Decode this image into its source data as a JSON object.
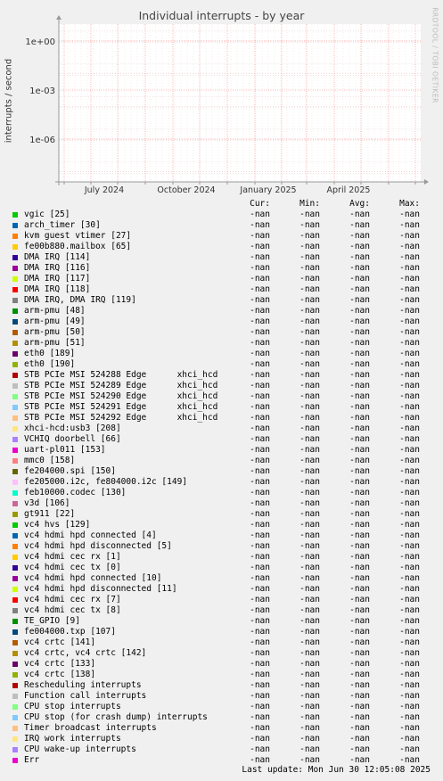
{
  "chart_data": {
    "type": "line",
    "title": "Individual interrupts - by year",
    "ylabel": "interrupts / second",
    "xlabel": "",
    "y_scale": "log",
    "y_ticks": [
      "1e+00",
      "1e-03",
      "1e-06"
    ],
    "x_ticks": [
      "July 2024",
      "October 2024",
      "January 2025",
      "April 2025"
    ],
    "grid": true,
    "series_values": "-nan",
    "series": [
      {
        "name": "vgic [25]",
        "color": "#00cc00",
        "cur": "-nan",
        "min": "-nan",
        "avg": "-nan",
        "max": "-nan"
      },
      {
        "name": "arch_timer [30]",
        "color": "#0066b3",
        "cur": "-nan",
        "min": "-nan",
        "avg": "-nan",
        "max": "-nan"
      },
      {
        "name": "kvm guest vtimer [27]",
        "color": "#ff8000",
        "cur": "-nan",
        "min": "-nan",
        "avg": "-nan",
        "max": "-nan"
      },
      {
        "name": "fe00b880.mailbox [65]",
        "color": "#ffcc00",
        "cur": "-nan",
        "min": "-nan",
        "avg": "-nan",
        "max": "-nan"
      },
      {
        "name": "DMA IRQ [114]",
        "color": "#330099",
        "cur": "-nan",
        "min": "-nan",
        "avg": "-nan",
        "max": "-nan"
      },
      {
        "name": "DMA IRQ [116]",
        "color": "#990099",
        "cur": "-nan",
        "min": "-nan",
        "avg": "-nan",
        "max": "-nan"
      },
      {
        "name": "DMA IRQ [117]",
        "color": "#ccff00",
        "cur": "-nan",
        "min": "-nan",
        "avg": "-nan",
        "max": "-nan"
      },
      {
        "name": "DMA IRQ [118]",
        "color": "#ff0000",
        "cur": "-nan",
        "min": "-nan",
        "avg": "-nan",
        "max": "-nan"
      },
      {
        "name": "DMA IRQ, DMA IRQ [119]",
        "color": "#808080",
        "cur": "-nan",
        "min": "-nan",
        "avg": "-nan",
        "max": "-nan"
      },
      {
        "name": "arm-pmu [48]",
        "color": "#008f00",
        "cur": "-nan",
        "min": "-nan",
        "avg": "-nan",
        "max": "-nan"
      },
      {
        "name": "arm-pmu [49]",
        "color": "#00487d",
        "cur": "-nan",
        "min": "-nan",
        "avg": "-nan",
        "max": "-nan"
      },
      {
        "name": "arm-pmu [50]",
        "color": "#b35a00",
        "cur": "-nan",
        "min": "-nan",
        "avg": "-nan",
        "max": "-nan"
      },
      {
        "name": "arm-pmu [51]",
        "color": "#b38f00",
        "cur": "-nan",
        "min": "-nan",
        "avg": "-nan",
        "max": "-nan"
      },
      {
        "name": "eth0 [189]",
        "color": "#6b006b",
        "cur": "-nan",
        "min": "-nan",
        "avg": "-nan",
        "max": "-nan"
      },
      {
        "name": "eth0 [190]",
        "color": "#8fb300",
        "cur": "-nan",
        "min": "-nan",
        "avg": "-nan",
        "max": "-nan"
      },
      {
        "name": "STB PCIe MSI 524288 Edge      xhci_hcd",
        "color": "#b30000",
        "cur": "-nan",
        "min": "-nan",
        "avg": "-nan",
        "max": "-nan"
      },
      {
        "name": "STB PCIe MSI 524289 Edge      xhci_hcd",
        "color": "#bebebe",
        "cur": "-nan",
        "min": "-nan",
        "avg": "-nan",
        "max": "-nan"
      },
      {
        "name": "STB PCIe MSI 524290 Edge      xhci_hcd",
        "color": "#80ff80",
        "cur": "-nan",
        "min": "-nan",
        "avg": "-nan",
        "max": "-nan"
      },
      {
        "name": "STB PCIe MSI 524291 Edge      xhci_hcd",
        "color": "#80c9ff",
        "cur": "-nan",
        "min": "-nan",
        "avg": "-nan",
        "max": "-nan"
      },
      {
        "name": "STB PCIe MSI 524292 Edge      xhci_hcd",
        "color": "#ffc080",
        "cur": "-nan",
        "min": "-nan",
        "avg": "-nan",
        "max": "-nan"
      },
      {
        "name": "xhci-hcd:usb3 [208]",
        "color": "#ffe680",
        "cur": "-nan",
        "min": "-nan",
        "avg": "-nan",
        "max": "-nan"
      },
      {
        "name": "VCHIQ doorbell [66]",
        "color": "#aa80ff",
        "cur": "-nan",
        "min": "-nan",
        "avg": "-nan",
        "max": "-nan"
      },
      {
        "name": "uart-pl011 [153]",
        "color": "#ee00cc",
        "cur": "-nan",
        "min": "-nan",
        "avg": "-nan",
        "max": "-nan"
      },
      {
        "name": "mmc0 [158]",
        "color": "#ff8080",
        "cur": "-nan",
        "min": "-nan",
        "avg": "-nan",
        "max": "-nan"
      },
      {
        "name": "fe204000.spi [150]",
        "color": "#666600",
        "cur": "-nan",
        "min": "-nan",
        "avg": "-nan",
        "max": "-nan"
      },
      {
        "name": "fe205000.i2c, fe804000.i2c [149]",
        "color": "#ffbfff",
        "cur": "-nan",
        "min": "-nan",
        "avg": "-nan",
        "max": "-nan"
      },
      {
        "name": "feb10000.codec [130]",
        "color": "#00ffcc",
        "cur": "-nan",
        "min": "-nan",
        "avg": "-nan",
        "max": "-nan"
      },
      {
        "name": "v3d [106]",
        "color": "#cc6699",
        "cur": "-nan",
        "min": "-nan",
        "avg": "-nan",
        "max": "-nan"
      },
      {
        "name": "gt911 [22]",
        "color": "#999900",
        "cur": "-nan",
        "min": "-nan",
        "avg": "-nan",
        "max": "-nan"
      },
      {
        "name": "vc4 hvs [129]",
        "color": "#00cc00",
        "cur": "-nan",
        "min": "-nan",
        "avg": "-nan",
        "max": "-nan"
      },
      {
        "name": "vc4 hdmi hpd connected [4]",
        "color": "#0066b3",
        "cur": "-nan",
        "min": "-nan",
        "avg": "-nan",
        "max": "-nan"
      },
      {
        "name": "vc4 hdmi hpd disconnected [5]",
        "color": "#ff8000",
        "cur": "-nan",
        "min": "-nan",
        "avg": "-nan",
        "max": "-nan"
      },
      {
        "name": "vc4 hdmi cec rx [1]",
        "color": "#ffcc00",
        "cur": "-nan",
        "min": "-nan",
        "avg": "-nan",
        "max": "-nan"
      },
      {
        "name": "vc4 hdmi cec tx [0]",
        "color": "#330099",
        "cur": "-nan",
        "min": "-nan",
        "avg": "-nan",
        "max": "-nan"
      },
      {
        "name": "vc4 hdmi hpd connected [10]",
        "color": "#990099",
        "cur": "-nan",
        "min": "-nan",
        "avg": "-nan",
        "max": "-nan"
      },
      {
        "name": "vc4 hdmi hpd disconnected [11]",
        "color": "#ccff00",
        "cur": "-nan",
        "min": "-nan",
        "avg": "-nan",
        "max": "-nan"
      },
      {
        "name": "vc4 hdmi cec rx [7]",
        "color": "#ff0000",
        "cur": "-nan",
        "min": "-nan",
        "avg": "-nan",
        "max": "-nan"
      },
      {
        "name": "vc4 hdmi cec tx [8]",
        "color": "#808080",
        "cur": "-nan",
        "min": "-nan",
        "avg": "-nan",
        "max": "-nan"
      },
      {
        "name": "TE_GPIO [9]",
        "color": "#008f00",
        "cur": "-nan",
        "min": "-nan",
        "avg": "-nan",
        "max": "-nan"
      },
      {
        "name": "fe004000.txp [107]",
        "color": "#00487d",
        "cur": "-nan",
        "min": "-nan",
        "avg": "-nan",
        "max": "-nan"
      },
      {
        "name": "vc4 crtc [141]",
        "color": "#b35a00",
        "cur": "-nan",
        "min": "-nan",
        "avg": "-nan",
        "max": "-nan"
      },
      {
        "name": "vc4 crtc, vc4 crtc [142]",
        "color": "#b38f00",
        "cur": "-nan",
        "min": "-nan",
        "avg": "-nan",
        "max": "-nan"
      },
      {
        "name": "vc4 crtc [133]",
        "color": "#6b006b",
        "cur": "-nan",
        "min": "-nan",
        "avg": "-nan",
        "max": "-nan"
      },
      {
        "name": "vc4 crtc [138]",
        "color": "#8fb300",
        "cur": "-nan",
        "min": "-nan",
        "avg": "-nan",
        "max": "-nan"
      },
      {
        "name": "Rescheduling interrupts",
        "color": "#b30000",
        "cur": "-nan",
        "min": "-nan",
        "avg": "-nan",
        "max": "-nan"
      },
      {
        "name": "Function call interrupts",
        "color": "#bebebe",
        "cur": "-nan",
        "min": "-nan",
        "avg": "-nan",
        "max": "-nan"
      },
      {
        "name": "CPU stop interrupts",
        "color": "#80ff80",
        "cur": "-nan",
        "min": "-nan",
        "avg": "-nan",
        "max": "-nan"
      },
      {
        "name": "CPU stop (for crash dump) interrupts",
        "color": "#80c9ff",
        "cur": "-nan",
        "min": "-nan",
        "avg": "-nan",
        "max": "-nan"
      },
      {
        "name": "Timer broadcast interrupts",
        "color": "#ffc080",
        "cur": "-nan",
        "min": "-nan",
        "avg": "-nan",
        "max": "-nan"
      },
      {
        "name": "IRQ work interrupts",
        "color": "#ffe680",
        "cur": "-nan",
        "min": "-nan",
        "avg": "-nan",
        "max": "-nan"
      },
      {
        "name": "CPU wake-up interrupts",
        "color": "#aa80ff",
        "cur": "-nan",
        "min": "-nan",
        "avg": "-nan",
        "max": "-nan"
      },
      {
        "name": "Err",
        "color": "#ee00cc",
        "cur": "-nan",
        "min": "-nan",
        "avg": "-nan",
        "max": "-nan"
      }
    ]
  },
  "legend_header": {
    "cur": "Cur:",
    "min": "Min:",
    "avg": "Avg:",
    "max": "Max:"
  },
  "watermark": "RRDTOOL / TOBI OETIKER",
  "footer": "Last update: Mon Jun 30 12:05:08 2025",
  "colors": {
    "background": "#f0f0f0",
    "plot_area": "#ffffff",
    "grid_major": "#ff9999",
    "grid_minor": "#e0c0c0",
    "axis": "#999999"
  }
}
